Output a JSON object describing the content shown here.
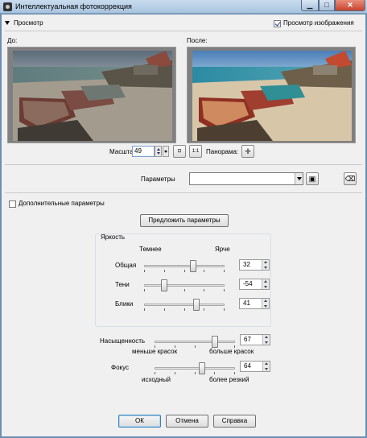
{
  "window": {
    "title": "Интеллектуальная фотокоррекция"
  },
  "preview": {
    "section_label": "Просмотр",
    "show_preview_label": "Просмотр изображения",
    "show_preview_checked": true,
    "before_label": "До:",
    "after_label": "После:"
  },
  "zoom": {
    "label": "Масштаб:",
    "value": "49",
    "pan_label": "Панорама:",
    "fit_icon": "fit-window-icon",
    "actual_icon": "actual-size-icon",
    "pan_icon": "pan-cross-icon"
  },
  "presets": {
    "label": "Параметры",
    "value": ""
  },
  "advanced": {
    "label": "Дополнительные параметры",
    "checked": false
  },
  "suggest_button": "Предложить параметры",
  "brightness": {
    "group_label": "Яркость",
    "darker_label": "Темнее",
    "brighter_label": "Ярче",
    "sliders": [
      {
        "label": "Общая",
        "value": "32",
        "position": 0.62
      },
      {
        "label": "Тени",
        "value": "-54",
        "position": 0.23
      },
      {
        "label": "Блики",
        "value": "41",
        "position": 0.66
      }
    ]
  },
  "saturation": {
    "label": "Насыщенность",
    "value": "67",
    "position": 0.77,
    "less_label": "меньше красок",
    "more_label": "больше красок"
  },
  "focus": {
    "label": "Фокус",
    "value": "64",
    "position": 0.6,
    "original_label": "исходный",
    "sharper_label": "более резкий"
  },
  "buttons": {
    "ok": "ОК",
    "cancel": "Отмена",
    "help": "Справка"
  },
  "colors": {
    "accent": "#3c7fb1",
    "title_bar": "#b7cfe6",
    "window_bg": "#f0f0f0"
  }
}
